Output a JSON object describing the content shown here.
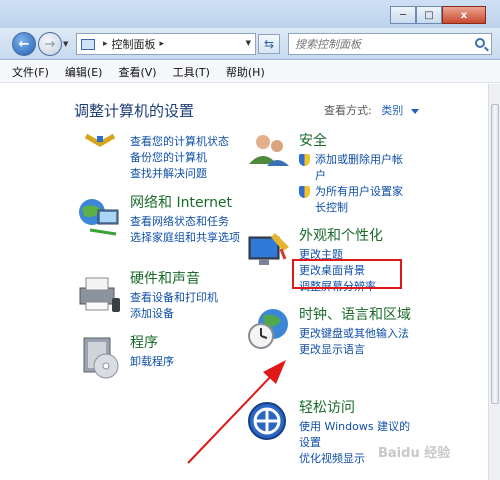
{
  "window": {
    "minimize": "─",
    "maximize": "□",
    "close": "x"
  },
  "nav": {
    "address_segment": "控制面板",
    "address_sep": "▸",
    "search_placeholder": "搜索控制面板"
  },
  "menu": [
    "文件(F)",
    "编辑(E)",
    "查看(V)",
    "工具(T)",
    "帮助(H)"
  ],
  "page": {
    "title": "调整计算机的设置",
    "view_by_label": "查看方式:",
    "view_by_value": "类别"
  },
  "categories": {
    "system": {
      "title": "",
      "links": [
        "查看您的计算机状态",
        "备份您的计算机",
        "查找并解决问题"
      ]
    },
    "security": {
      "title": "安全",
      "links": [
        "添加或删除用户帐户",
        "为所有用户设置家长控制"
      ]
    },
    "network": {
      "title": "网络和 Internet",
      "links": [
        "查看网络状态和任务",
        "选择家庭组和共享选项"
      ]
    },
    "appearance": {
      "title": "外观和个性化",
      "links": [
        "更改主题",
        "更改桌面背景",
        "调整屏幕分辨率"
      ]
    },
    "hardware": {
      "title": "硬件和声音",
      "links": [
        "查看设备和打印机",
        "添加设备"
      ]
    },
    "clock": {
      "title": "时钟、语言和区域",
      "links": [
        "更改键盘或其他输入法",
        "更改显示语言"
      ]
    },
    "programs": {
      "title": "程序",
      "links": [
        "卸载程序"
      ]
    },
    "ease": {
      "title": "轻松访问",
      "links": [
        "使用 Windows 建议的设置",
        "优化视频显示"
      ]
    }
  },
  "watermark": "Baidu 经验",
  "colors": {
    "accent": "#1f5fbf",
    "category_title": "#1a6b2a",
    "highlight": "#e01818"
  }
}
